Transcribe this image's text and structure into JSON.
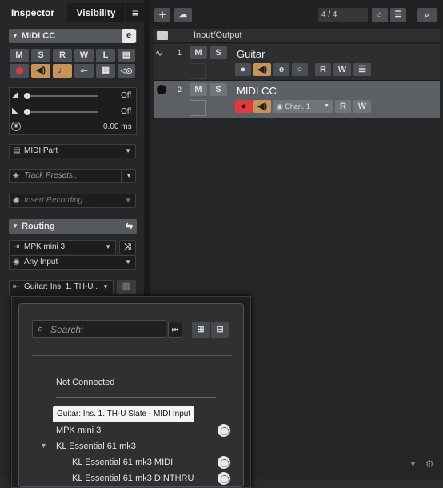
{
  "inspector": {
    "tabs": [
      "Inspector",
      "Visibility"
    ],
    "menu_icon": "menu-icon",
    "track_name": "MIDI CC",
    "row1": [
      "M",
      "S",
      "R",
      "W",
      "L"
    ],
    "volume_value": "Off",
    "pan_value": "Off",
    "delay_value": "0.00 ms",
    "part_type": "MIDI Part",
    "track_presets": "Track Presets...",
    "insert_recording": "Insert Recording...",
    "routing_label": "Routing",
    "input_device": "MPK mini 3",
    "input_channel": "Any Input",
    "output": "Guitar: Ins. 1. TH-U ."
  },
  "toolbar": {
    "counter": "4 / 4"
  },
  "tracks": {
    "folder_name": "Input/Output",
    "list": [
      {
        "num": "1",
        "name": "Guitar",
        "icon": "audio-waveform-icon"
      },
      {
        "num": "2",
        "name": "MIDI CC",
        "icon": "midi-port-icon",
        "channel": "Chan. 1"
      }
    ],
    "m_label": "M",
    "s_label": "S",
    "r_label": "R",
    "w_label": "W"
  },
  "popup": {
    "search_placeholder": "Search:",
    "items": {
      "not_connected": "Not Connected",
      "selected": "Guitar: Ins. 1. TH-U Slate - MIDI Input",
      "mpk": "MPK mini 3",
      "kl_group": "KL Essential 61 mk3",
      "kl_midi": "KL Essential 61 mk3 MIDI",
      "kl_din": "KL Essential 61 mk3 DINTHRU"
    }
  },
  "colors": {
    "record": "#e0393e",
    "monitor": "#d09a5c",
    "panel": "#262729"
  }
}
